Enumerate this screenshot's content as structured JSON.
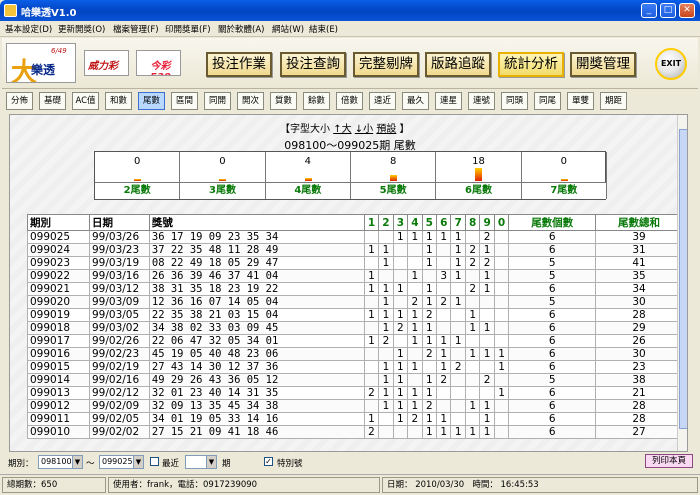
{
  "window": {
    "title": "哈樂透V1.0",
    "min": "_",
    "max": "□",
    "close": "✕"
  },
  "menu": [
    "基本設定(D)",
    "更新開獎(O)",
    "檔案管理(F)",
    "印開獎單(F)",
    "關於軟體(A)",
    "網站(W)",
    "結束(E)"
  ],
  "logos": {
    "lotto649_big": "大",
    "lotto649_small": "樂透",
    "lotto649_sup": "6/49",
    "power": "威力彩",
    "l539": "今彩539"
  },
  "big_buttons": [
    "投注作業",
    "投注查詢",
    "完整剔牌",
    "版路追蹤",
    "統計分析",
    "開獎管理"
  ],
  "exit_label": "EXIT",
  "tabs": [
    "分佈",
    "基礎",
    "AC值",
    "和數",
    "尾數",
    "區間",
    "同開",
    "開次",
    "質數",
    "餘數",
    "倍數",
    "遠近",
    "最久",
    "連星",
    "連號",
    "同頭",
    "同尾",
    "單雙",
    "期距"
  ],
  "active_tab": "尾數",
  "font_size_row": {
    "prefix": "【字型大小",
    "big": "↑大",
    "small": "↓小",
    "preset": "預設",
    "suffix": "】"
  },
  "range_title": "098100～099025期 尾數",
  "summary": [
    {
      "count": "0",
      "value": 0,
      "label": "2尾數"
    },
    {
      "count": "0",
      "value": 0,
      "label": "3尾數"
    },
    {
      "count": "4",
      "value": 4,
      "label": "4尾數"
    },
    {
      "count": "8",
      "value": 8,
      "label": "5尾數"
    },
    {
      "count": "18",
      "value": 18,
      "label": "6尾數"
    },
    {
      "count": "0",
      "value": 0,
      "label": "7尾數"
    }
  ],
  "table": {
    "headers": {
      "period": "期別",
      "date": "日期",
      "numbers": "獎號",
      "digits": [
        "1",
        "2",
        "3",
        "4",
        "5",
        "6",
        "7",
        "8",
        "9",
        "0"
      ],
      "tail_count": "尾數個數",
      "tail_sum": "尾數總和"
    },
    "rows": [
      {
        "period": "099025",
        "date": "99/03/26",
        "numbers": "36 17 19 09 23 35 34",
        "d": [
          "",
          "",
          "1",
          "1",
          "1",
          "1",
          "1",
          "",
          "2",
          ""
        ],
        "count": "6",
        "sum": "39"
      },
      {
        "period": "099024",
        "date": "99/03/23",
        "numbers": "37 22 35 48 11 28 49",
        "d": [
          "1",
          "1",
          "",
          "",
          "1",
          "",
          "1",
          "2",
          "1",
          ""
        ],
        "count": "6",
        "sum": "31"
      },
      {
        "period": "099023",
        "date": "99/03/19",
        "numbers": "08 22 49 18 05 29 47",
        "d": [
          "",
          "1",
          "",
          "",
          "1",
          "",
          "1",
          "2",
          "2",
          ""
        ],
        "count": "5",
        "sum": "41"
      },
      {
        "period": "099022",
        "date": "99/03/16",
        "numbers": "26 36 39 46 37 41 04",
        "d": [
          "1",
          "",
          "",
          "1",
          "",
          "3",
          "1",
          "",
          "1",
          ""
        ],
        "count": "5",
        "sum": "35"
      },
      {
        "period": "099021",
        "date": "99/03/12",
        "numbers": "38 31 35 18 23 19 22",
        "d": [
          "1",
          "1",
          "1",
          "",
          "1",
          "",
          "",
          "2",
          "1",
          ""
        ],
        "count": "6",
        "sum": "34"
      },
      {
        "period": "099020",
        "date": "99/03/09",
        "numbers": "12 36 16 07 14 05 04",
        "d": [
          "",
          "1",
          "",
          "2",
          "1",
          "2",
          "1",
          "",
          "",
          ""
        ],
        "count": "5",
        "sum": "30"
      },
      {
        "period": "099019",
        "date": "99/03/05",
        "numbers": "22 35 38 21 03 15 04",
        "d": [
          "1",
          "1",
          "1",
          "1",
          "2",
          "",
          "",
          "1",
          "",
          ""
        ],
        "count": "6",
        "sum": "28"
      },
      {
        "period": "099018",
        "date": "99/03/02",
        "numbers": "34 38 02 33 03 09 45",
        "d": [
          "",
          "1",
          "2",
          "1",
          "1",
          "",
          "",
          "1",
          "1",
          ""
        ],
        "count": "6",
        "sum": "29"
      },
      {
        "period": "099017",
        "date": "99/02/26",
        "numbers": "22 06 47 32 05 34 01",
        "d": [
          "1",
          "2",
          "",
          "1",
          "1",
          "1",
          "1",
          "",
          "",
          ""
        ],
        "count": "6",
        "sum": "26"
      },
      {
        "period": "099016",
        "date": "99/02/23",
        "numbers": "45 19 05 40 48 23 06",
        "d": [
          "",
          "",
          "1",
          "",
          "2",
          "1",
          "",
          "1",
          "1",
          "1"
        ],
        "count": "6",
        "sum": "30"
      },
      {
        "period": "099015",
        "date": "99/02/19",
        "numbers": "27 43 14 30 12 37 36",
        "d": [
          "",
          "1",
          "1",
          "1",
          "",
          "1",
          "2",
          "",
          "",
          "1"
        ],
        "count": "6",
        "sum": "23"
      },
      {
        "period": "099014",
        "date": "99/02/16",
        "numbers": "49 29 26 43 36 05 12",
        "d": [
          "",
          "1",
          "1",
          "",
          "1",
          "2",
          "",
          "",
          "2",
          ""
        ],
        "count": "5",
        "sum": "38"
      },
      {
        "period": "099013",
        "date": "99/02/12",
        "numbers": "32 01 23 40 14 31 35",
        "d": [
          "2",
          "1",
          "1",
          "1",
          "1",
          "",
          "",
          "",
          "",
          "1"
        ],
        "count": "6",
        "sum": "21"
      },
      {
        "period": "099012",
        "date": "99/02/09",
        "numbers": "32 09 13 35 45 34 38",
        "d": [
          "",
          "1",
          "1",
          "1",
          "2",
          "",
          "",
          "1",
          "1",
          ""
        ],
        "count": "6",
        "sum": "28"
      },
      {
        "period": "099011",
        "date": "99/02/05",
        "numbers": "34 01 19 05 33 14 16",
        "d": [
          "1",
          "",
          "1",
          "2",
          "1",
          "1",
          "",
          "",
          "1",
          ""
        ],
        "count": "6",
        "sum": "28"
      },
      {
        "period": "099010",
        "date": "99/02/02",
        "numbers": "27 15 21 09 41 18 46",
        "d": [
          "2",
          "",
          "",
          "",
          "1",
          "1",
          "1",
          "1",
          "1",
          ""
        ],
        "count": "6",
        "sum": "27"
      }
    ]
  },
  "bottom": {
    "period_label": "期別：",
    "from": "098100",
    "tilde": "～",
    "to": "099025",
    "recent_label": "最近",
    "recent_value": "",
    "period_unit": "期",
    "special_label": "特別號",
    "special_checked": true,
    "print": "列印本頁"
  },
  "status": {
    "total": "總期數：650",
    "user": "使用者：frank，電話：0917239090",
    "date": "日期： 2010/03/30",
    "time": "時間： 16:45:53"
  }
}
